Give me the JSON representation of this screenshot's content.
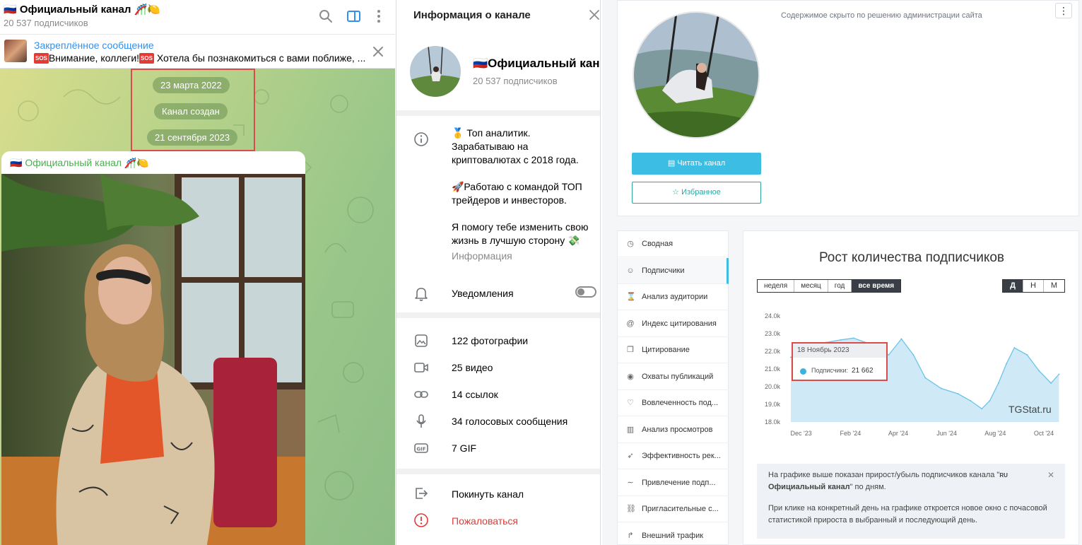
{
  "chat": {
    "title": "🇷🇺 Официальный канал 🎢🍋",
    "subscribers": "20 537 подписчиков",
    "pinned_title": "Закреплённое сообщение",
    "pinned_text_a": "Внимание, коллеги!",
    "pinned_text_b": "Хотела бы познакомиться с вами поближе, ...",
    "sos_badge": "SOS",
    "service_date_1": "23 марта 2022",
    "service_created": "Канал создан",
    "service_date_2": "21 сентября 2023",
    "message_author": "🇷🇺 Официальный канал 🎢🍋"
  },
  "info": {
    "header": "Информация о канале",
    "name": "🇷🇺Официальный канал",
    "subscribers": "20 537 подписчиков",
    "description": [
      "🥇 Топ аналитик.",
      "Зарабатываю на",
      "криптовалютах с 2018 года.",
      "",
      "🚀Работаю с командой ТОП",
      "трейдеров и инвесторов.",
      "",
      "Я помогу тебе изменить свою",
      "жизнь в лучшую сторону 💸"
    ],
    "description_caption": "Информация",
    "notifications_label": "Уведомления",
    "notifications_on": false,
    "media": {
      "photos": "122 фотографии",
      "videos": "25 видео",
      "links": "14 ссылок",
      "voice": "34 голосовых сообщения",
      "gif": "7 GIF"
    },
    "leave": "Покинуть канал",
    "report": "Пожаловаться"
  },
  "stat": {
    "hidden_note": "Содержимое скрыто по решению администрации сайта",
    "more": "⋮",
    "read_button": "Читать канал",
    "fav_button": "Избранное",
    "menu": [
      {
        "icon": "◷",
        "label": "Сводная"
      },
      {
        "icon": "☺",
        "label": "Подписчики"
      },
      {
        "icon": "⌛",
        "label": "Анализ аудитории"
      },
      {
        "icon": "@",
        "label": "Индекс цитирования"
      },
      {
        "icon": "❐",
        "label": "Цитирование"
      },
      {
        "icon": "◉",
        "label": "Охваты публикаций"
      },
      {
        "icon": "♡",
        "label": "Вовлеченность под..."
      },
      {
        "icon": "▥",
        "label": "Анализ просмотров"
      },
      {
        "icon": "➶",
        "label": "Эффективность рек..."
      },
      {
        "icon": "∼",
        "label": "Привлечение подп..."
      },
      {
        "icon": "⛓",
        "label": "Пригласительные с..."
      },
      {
        "icon": "↱",
        "label": "Внешний трафик"
      }
    ],
    "active_menu_index": 1,
    "chart_title": "Рост количества подписчиков",
    "ranges": [
      "неделя",
      "месяц",
      "год",
      "все время"
    ],
    "active_range": "все время",
    "periods": [
      "Д",
      "Н",
      "М"
    ],
    "active_period": "Д",
    "tooltip_date": "18 Ноябрь 2023",
    "tooltip_label": "Подписчики:",
    "tooltip_value": "21 662",
    "watermark": "TGStat.ru",
    "note_line_1a": "На графике выше показан прирост/убыль подписчиков канала \"",
    "note_ru": "RU",
    "note_line_1b": " Официальный канал",
    "note_line_1c": "\" по дням.",
    "note_line_2": "При клике на конкретный день на графике откроется новое окно с почасовой статистикой прироста в выбранный и последующий день.",
    "accent_color": "#3cbde4"
  },
  "chart_data": {
    "type": "area",
    "title": "Рост количества подписчиков",
    "y_ticks": [
      "24.0k",
      "23.0k",
      "22.0k",
      "21.0k",
      "20.0k",
      "19.0k",
      "18.0k"
    ],
    "ylim": [
      18000,
      24000
    ],
    "x_ticks": [
      "Dec '23",
      "Feb '24",
      "Apr '24",
      "Jun '24",
      "Aug '24",
      "Oct '24"
    ],
    "series": [
      {
        "name": "Подписчики",
        "x": [
          "2023-11-18",
          "2023-12-15",
          "2024-01-01",
          "2024-01-20",
          "2024-02-05",
          "2024-02-20",
          "2024-03-05",
          "2024-03-20",
          "2024-04-05",
          "2024-04-20",
          "2024-05-05",
          "2024-05-25",
          "2024-06-15",
          "2024-07-01",
          "2024-07-15",
          "2024-07-25",
          "2024-08-05",
          "2024-08-15",
          "2024-08-25",
          "2024-09-10",
          "2024-09-25",
          "2024-10-10",
          "2024-10-20"
        ],
        "y": [
          21662,
          22300,
          22500,
          22650,
          22750,
          22500,
          22100,
          21800,
          22700,
          21800,
          20500,
          19900,
          19600,
          19200,
          18750,
          19200,
          20200,
          21300,
          22200,
          21800,
          20900,
          20200,
          20700
        ]
      }
    ],
    "grid": false,
    "legend": "none"
  }
}
